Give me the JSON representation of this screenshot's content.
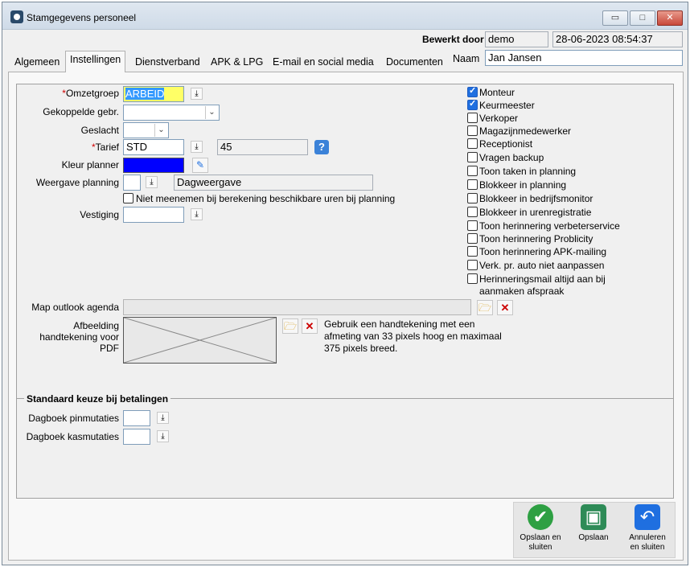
{
  "window": {
    "title": "Stamgegevens personeel",
    "minimize": "▭",
    "maximize": "□",
    "close": "✕"
  },
  "header": {
    "bewerkt_door_label": "Bewerkt door",
    "bewerkt_door_value": "demo",
    "timestamp": "28-06-2023 08:54:37",
    "naam_label": "Naam",
    "naam_value": "Jan Jansen"
  },
  "tabs": [
    "Algemeen",
    "Instellingen",
    "Dienstverband",
    "APK & LPG",
    "E-mail en social media",
    "Documenten"
  ],
  "active_tab": "Instellingen",
  "form": {
    "omzetgroep_label": "Omzetgroep",
    "omzetgroep_value": "ARBEID",
    "gekoppelde_label": "Gekoppelde gebr.",
    "gekoppelde_value": "",
    "geslacht_label": "Geslacht",
    "geslacht_value": "",
    "tarief_label": "Tarief",
    "tarief_value": "STD",
    "tarief_amount": "45",
    "kleur_label": "Kleur planner",
    "kleur_color": "#0000ff",
    "weergave_label": "Weergave planning",
    "weergave_value": "",
    "weergave_text": "Dagweergave",
    "niet_meenemen_label": "Niet meenemen bij berekening beschikbare uren bij planning",
    "vestiging_label": "Vestiging",
    "vestiging_value": "",
    "map_outlook_label": "Map outlook agenda",
    "map_outlook_value": "",
    "afbeelding_label": [
      "Afbeelding",
      "handtekening voor",
      "PDF"
    ],
    "afbeelding_hint": [
      "Gebruik een handtekening met een",
      "afmeting van 33 pixels hoog en maximaal",
      "375 pixels breed."
    ],
    "req_mark": "*"
  },
  "checkboxes": [
    {
      "label": "Monteur",
      "checked": true
    },
    {
      "label": "Keurmeester",
      "checked": true
    },
    {
      "label": "Verkoper",
      "checked": false
    },
    {
      "label": "Magazijnmedewerker",
      "checked": false
    },
    {
      "label": "Receptionist",
      "checked": false
    },
    {
      "label": "Vragen backup",
      "checked": false
    },
    {
      "label": "Toon taken in planning",
      "checked": false
    },
    {
      "label": "Blokkeer in planning",
      "checked": false
    },
    {
      "label": "Blokkeer in bedrijfsmonitor",
      "checked": false
    },
    {
      "label": "Blokkeer in urenregistratie",
      "checked": false
    },
    {
      "label": "Toon herinnering verbeterservice",
      "checked": false
    },
    {
      "label": "Toon herinnering Problicity",
      "checked": false
    },
    {
      "label": "Toon herinnering APK-mailing",
      "checked": false
    },
    {
      "label": "Verk. pr. auto niet aanpassen",
      "checked": false
    },
    {
      "label": "Herinneringsmail altijd aan bij aanmaken afspraak",
      "checked": false
    }
  ],
  "betalingen": {
    "title": "Standaard keuze bij betalingen",
    "pin_label": "Dagboek pinmutaties",
    "pin_value": "",
    "kas_label": "Dagboek kasmutaties",
    "kas_value": ""
  },
  "actions": {
    "save_close": [
      "Opslaan en",
      "sluiten"
    ],
    "save": "Opslaan",
    "cancel_close": [
      "Annuleren",
      "en sluiten"
    ]
  },
  "icons": {
    "lookup": "arrow-down-to-line-icon",
    "help": "question-icon",
    "color_picker": "color-pencils-icon",
    "folder": "folder-open-icon",
    "delete": "red-x-icon"
  },
  "colors": {
    "accent": "#1f6fe0",
    "highlight": "#ffff66",
    "selection": "#3399ff",
    "save_close": "#2ea043",
    "save": "#2e8b57",
    "cancel": "#1f6fe0"
  }
}
